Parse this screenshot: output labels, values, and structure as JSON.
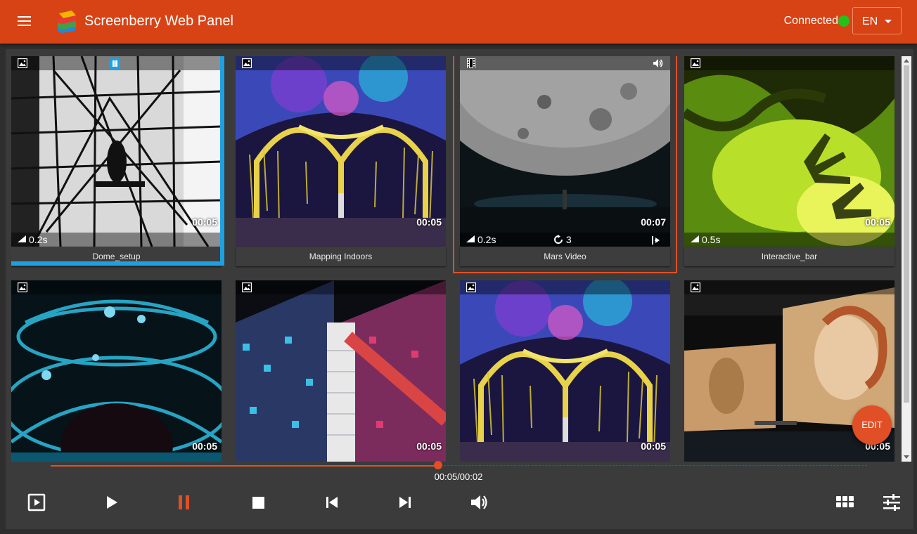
{
  "header": {
    "title": "Screenberry Web Panel",
    "status": "Connected",
    "status_color": "#22c21a",
    "language": "EN",
    "accent": "#d84315"
  },
  "grid": {
    "items": [
      {
        "name": "Dome_setup",
        "type": "image",
        "duration": "00:05",
        "fade": "0.2s",
        "state": "selected-paused",
        "theme": "dome"
      },
      {
        "name": "Mapping Indoors",
        "type": "image",
        "duration": "00:05",
        "theme": "arches"
      },
      {
        "name": "Mars Video",
        "type": "video",
        "duration": "00:07",
        "fade": "0.2s",
        "loops": "3",
        "state": "outlined",
        "theme": "moon"
      },
      {
        "name": "Interactive_bar",
        "type": "image",
        "duration": "00:05",
        "fade": "0.5s",
        "theme": "green"
      },
      {
        "name": "",
        "type": "image",
        "duration": "00:05",
        "theme": "blue"
      },
      {
        "name": "",
        "type": "image",
        "duration": "00:05",
        "theme": "building"
      },
      {
        "name": "",
        "type": "image",
        "duration": "00:05",
        "theme": "arches"
      },
      {
        "name": "",
        "type": "image",
        "duration": "00:05",
        "theme": "gallery"
      }
    ]
  },
  "edit_label": "EDIT",
  "timeline": {
    "progress": 0.475,
    "time": "00:05/00:02"
  },
  "controls": {
    "items": [
      "preview-icon",
      "play-icon",
      "pause-icon",
      "stop-icon",
      "skip-previous-icon",
      "skip-next-icon",
      "volume-icon"
    ],
    "right": [
      "grid-view-icon",
      "settings-sliders-icon"
    ],
    "active_color": "#e14f26"
  }
}
